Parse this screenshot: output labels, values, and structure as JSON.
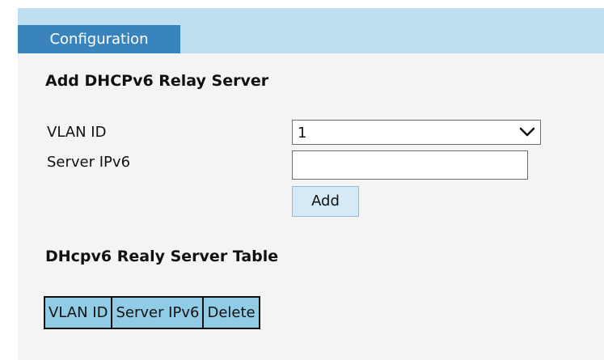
{
  "tabs": {
    "active_label": "Configuration"
  },
  "add_section": {
    "title": "Add DHCPv6 Relay Server",
    "vlan_label": "VLAN ID",
    "vlan_value": "1",
    "server_label": "Server IPv6",
    "server_value": "",
    "add_button_label": "Add"
  },
  "table_section": {
    "title": "DHcpv6 Realy Server Table",
    "columns": [
      "VLAN ID",
      "Server IPv6",
      "Delete"
    ]
  },
  "colors": {
    "tab_active": "#3a84be",
    "tabbar": "#bedff0",
    "table_header": "#90cce5",
    "button_bg": "#d6e9f6"
  }
}
